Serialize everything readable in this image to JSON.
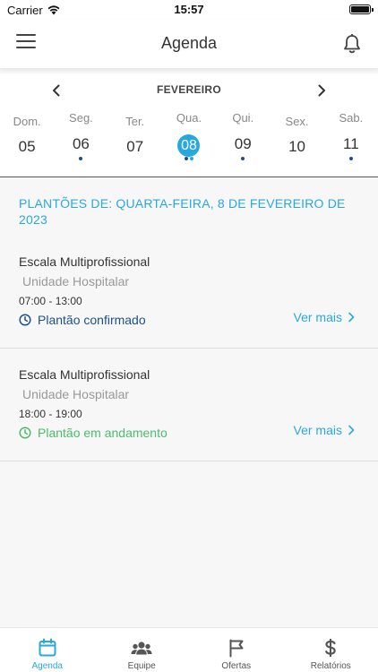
{
  "status_bar": {
    "carrier": "Carrier",
    "time": "15:57"
  },
  "header": {
    "title": "Agenda"
  },
  "calendar": {
    "month": "FEVEREIRO",
    "days": [
      {
        "dow": "Dom.",
        "num": "05"
      },
      {
        "dow": "Seg.",
        "num": "06"
      },
      {
        "dow": "Ter.",
        "num": "07"
      },
      {
        "dow": "Qua.",
        "num": "08"
      },
      {
        "dow": "Qui.",
        "num": "09"
      },
      {
        "dow": "Sex.",
        "num": "10"
      },
      {
        "dow": "Sab.",
        "num": "11"
      }
    ]
  },
  "date_heading": "PLANTÕES DE: QUARTA-FEIRA, 8 DE FEVEREIRO DE 2023",
  "shifts": [
    {
      "title": "Escala Multiprofissional",
      "unit": "Unidade Hospitalar",
      "time": "07:00 - 13:00",
      "status": "Plantão confirmado",
      "action": "Ver mais"
    },
    {
      "title": "Escala Multiprofissional",
      "unit": "Unidade Hospitalar",
      "time": "18:00 - 19:00",
      "status": "Plantão em andamento",
      "action": "Ver mais"
    }
  ],
  "tabs": [
    {
      "label": "Agenda",
      "icon": "calendar-icon"
    },
    {
      "label": "Equipe",
      "icon": "team-icon"
    },
    {
      "label": "Ofertas",
      "icon": "flag-icon"
    },
    {
      "label": "Relatórios",
      "icon": "dollar-icon"
    }
  ],
  "colors": {
    "accent": "#29a8df",
    "confirmed": "#1f4f8a",
    "in_progress": "#4cbb6c"
  }
}
